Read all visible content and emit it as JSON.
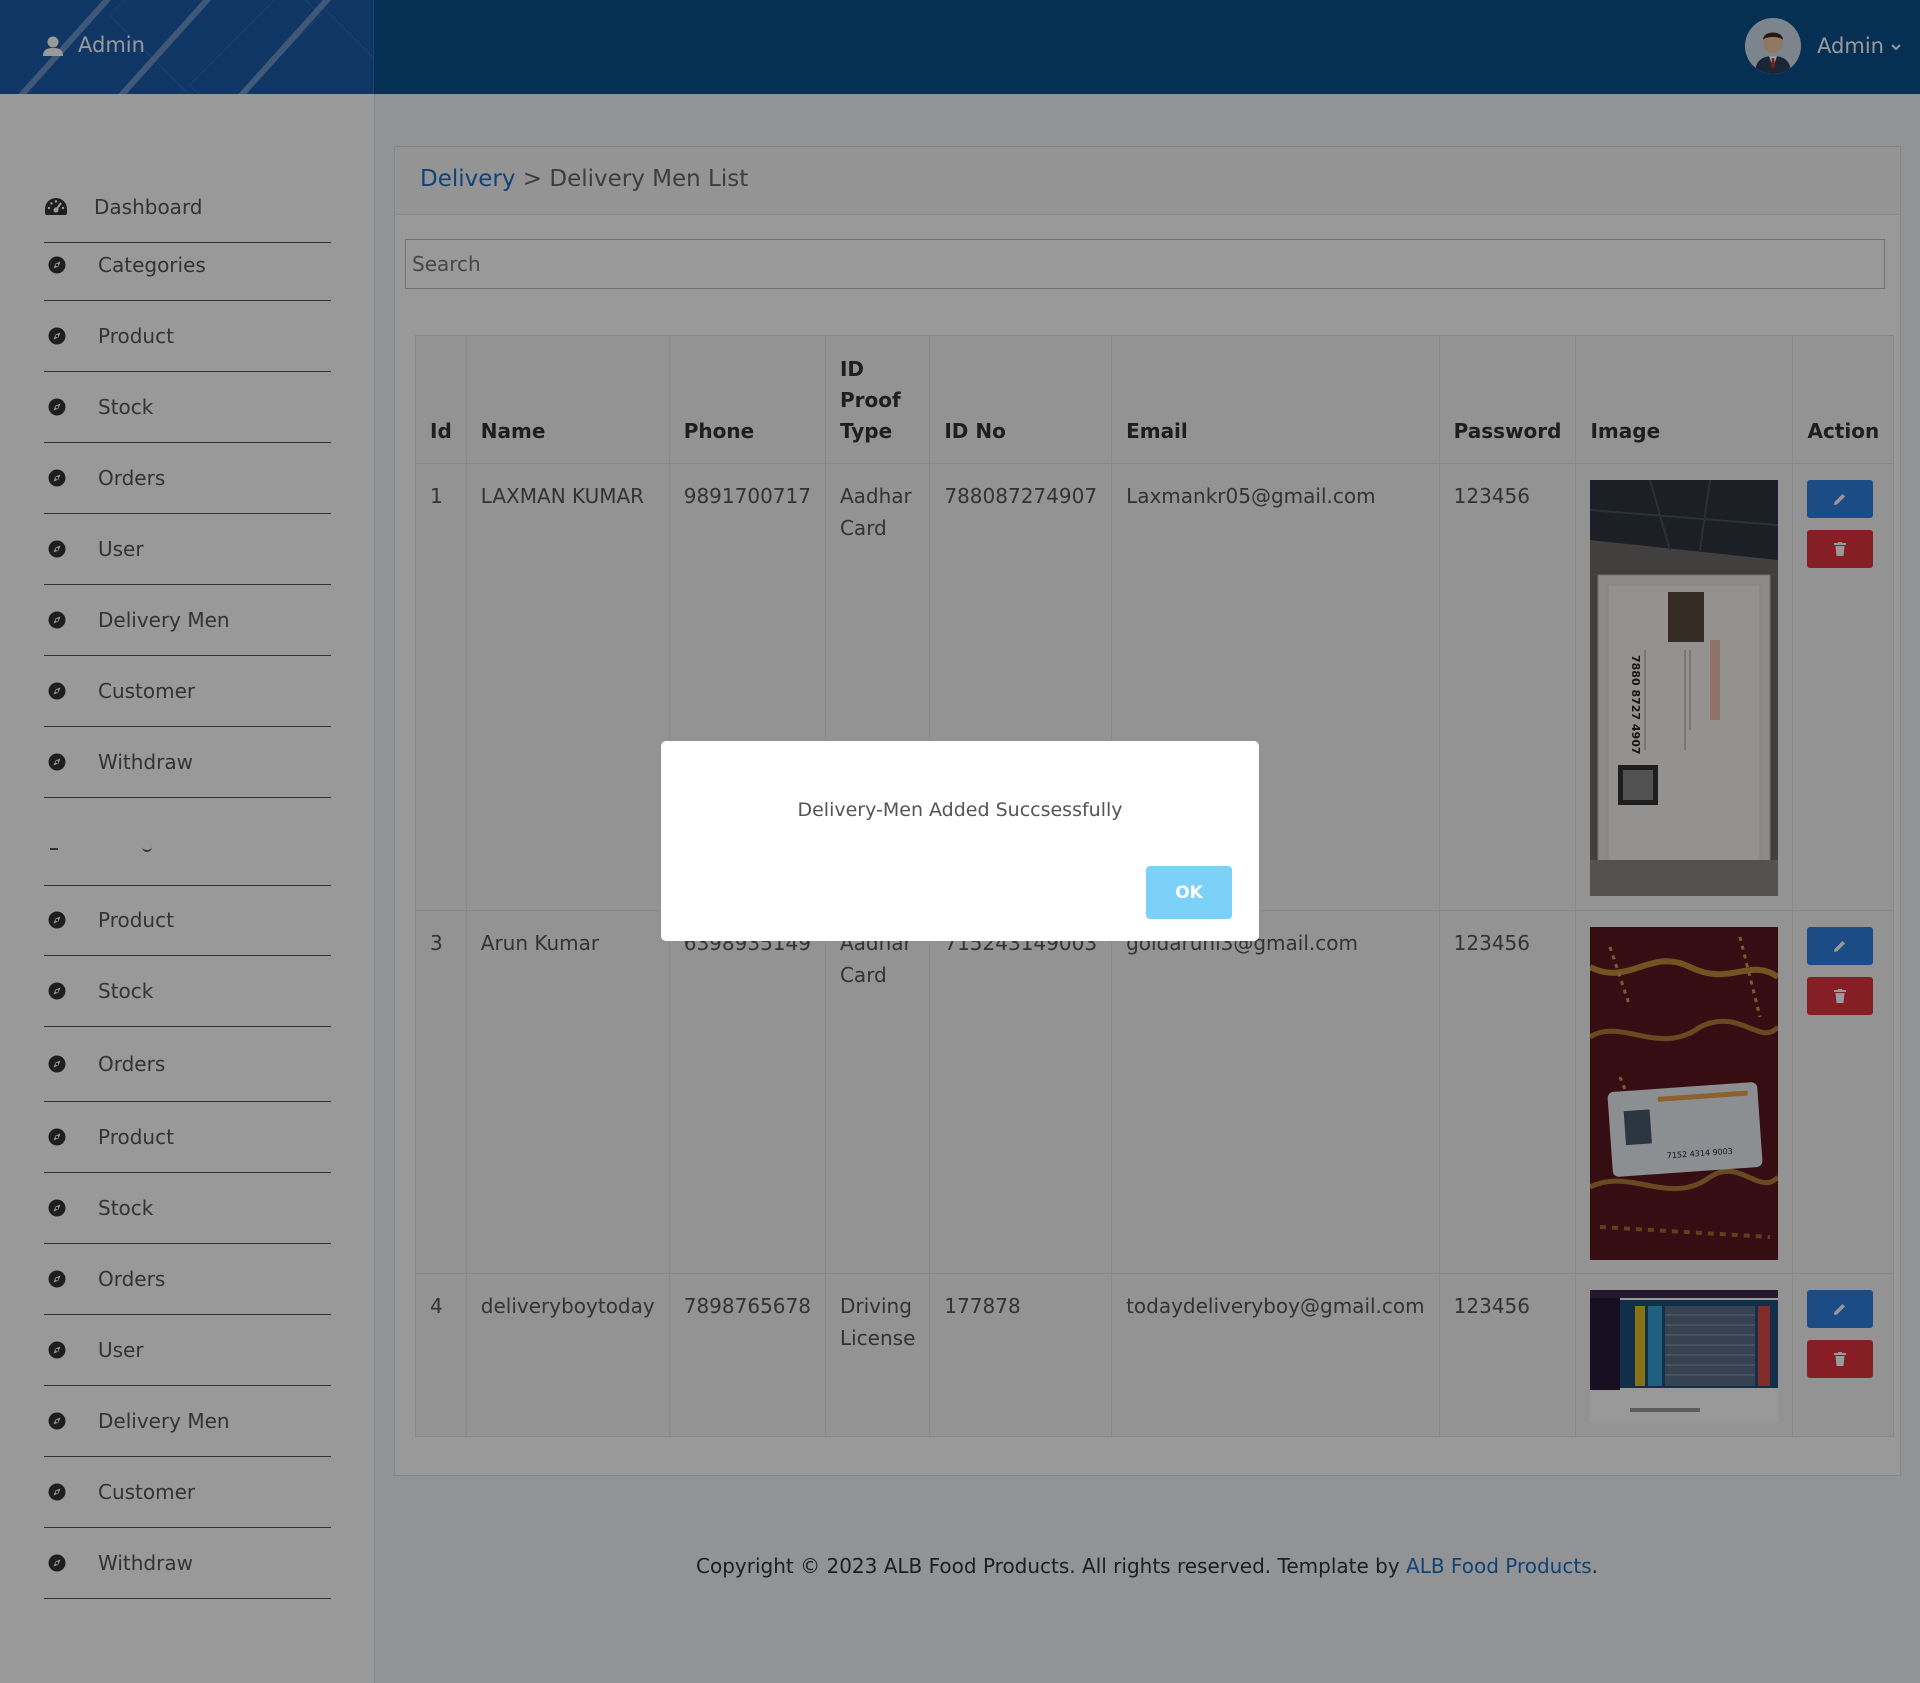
{
  "header": {
    "brand_label": "Admin",
    "user_name": "Admin"
  },
  "sidebar": {
    "items": [
      {
        "label": "Dashboard",
        "icon": "dashboard-icon"
      },
      {
        "label": "Categories",
        "icon": "compass-icon"
      },
      {
        "label": "Product",
        "icon": "compass-icon"
      },
      {
        "label": "Stock",
        "icon": "compass-icon"
      },
      {
        "label": "Orders",
        "icon": "compass-icon"
      },
      {
        "label": "User",
        "icon": "compass-icon"
      },
      {
        "label": "Delivery Men",
        "icon": "compass-icon"
      },
      {
        "label": "Customer",
        "icon": "compass-icon"
      },
      {
        "label": "Withdraw",
        "icon": "compass-icon"
      },
      {
        "label": "Product",
        "icon": "compass-icon"
      },
      {
        "label": "Stock",
        "icon": "compass-icon"
      },
      {
        "label": "Orders",
        "icon": "compass-icon"
      },
      {
        "label": "Product",
        "icon": "compass-icon"
      },
      {
        "label": "Stock",
        "icon": "compass-icon"
      },
      {
        "label": "Orders",
        "icon": "compass-icon"
      },
      {
        "label": "User",
        "icon": "compass-icon"
      },
      {
        "label": "Delivery Men",
        "icon": "compass-icon"
      },
      {
        "label": "Customer",
        "icon": "compass-icon"
      },
      {
        "label": "Withdraw",
        "icon": "compass-icon"
      }
    ]
  },
  "breadcrumb": {
    "parent": "Delivery",
    "separator": ">",
    "current": "Delivery Men List"
  },
  "search": {
    "placeholder": "Search"
  },
  "table": {
    "headers": {
      "id": "Id",
      "name": "Name",
      "phone": "Phone",
      "id_proof_type": "ID Proof Type",
      "id_no": "ID No",
      "email": "Email",
      "password": "Password",
      "image": "Image",
      "action": "Action"
    },
    "rows": [
      {
        "id": "1",
        "name": "LAXMAN KUMAR",
        "phone": "9891700717",
        "id_proof_type": "Aadhar Card",
        "id_no": "788087274907",
        "email": "Laxmankr05@gmail.com",
        "password": "123456"
      },
      {
        "id": "3",
        "name": "Arun Kumar",
        "phone": "6398935149",
        "id_proof_type": "Aadhar Card",
        "id_no": "715243149003",
        "email": "goldaruni3@gmail.com",
        "password": "123456"
      },
      {
        "id": "4",
        "name": "deliveryboytoday",
        "phone": "7898765678",
        "id_proof_type": "Driving License",
        "id_no": "177878",
        "email": "todaydeliveryboy@gmail.com",
        "password": "123456"
      }
    ],
    "row_image_caption": "7880 8727 4907",
    "row2_image_caption": "7152 4314 9003"
  },
  "footer": {
    "text": "Copyright © 2023 ALB Food Products. All rights reserved. Template by ",
    "link": "ALB Food Products",
    "end": "."
  },
  "modal": {
    "message": "Delivery-Men Added Succsessfully",
    "ok_label": "OK"
  },
  "colors": {
    "topbar": "#0b4f8c",
    "brand": "#1b5aa8",
    "link": "#1d6fc7",
    "edit_button": "#2d7fe0",
    "delete_button": "#e0323e",
    "ok_button": "#7cd1f9"
  }
}
